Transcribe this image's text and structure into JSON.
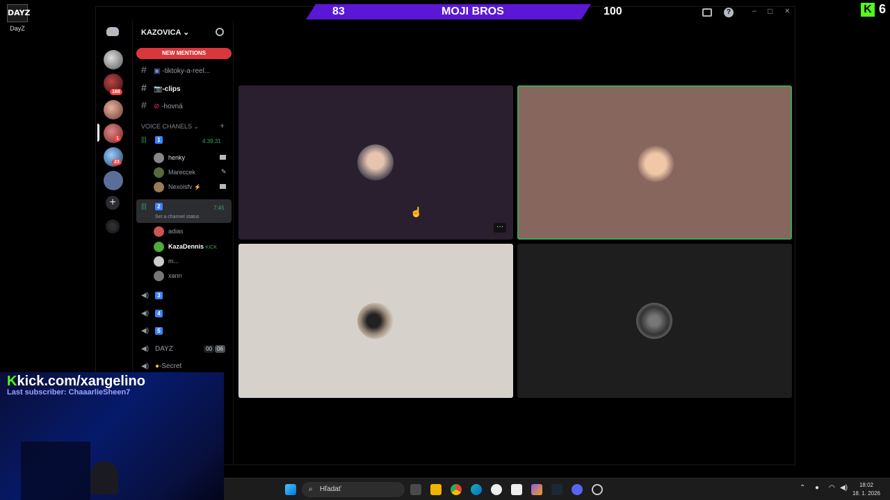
{
  "desktop": {
    "icon_label": "DayZ",
    "icon_text": "DAYZ"
  },
  "overlay_top_right": {
    "k": "K",
    "count": "6"
  },
  "scoreboard": {
    "left_score": "83",
    "title": "MOJI BROS",
    "right_score": "100"
  },
  "window_controls": {
    "inbox_icon": "inbox-icon",
    "help_icon": "?",
    "minimize": "–",
    "maximize": "□",
    "close": "✕"
  },
  "server": {
    "name": "KAZOVICA",
    "chevron": "⌄",
    "new_mentions": "NEW MENTIONS",
    "text_channels": [
      {
        "name": "-tiktoky-a-reel...",
        "emoji": "▣"
      },
      {
        "name": "-clips",
        "emoji": "📷"
      },
      {
        "name": "-hovná",
        "emoji": "⊘"
      }
    ],
    "voice_header": "VOICE CHANELS",
    "voice_header_chevron": "⌄",
    "add": "+",
    "voice_channels": [
      {
        "num": "1",
        "time": "4:39:31",
        "users": [
          "henky",
          "Mareccek",
          "Nexoisfv"
        ]
      },
      {
        "num": "2",
        "time": "7:45",
        "status": "Set a channel status",
        "users": [
          "adias",
          "KazaDennis",
          "m...",
          "xann"
        ],
        "user_tags": {
          "KazaDennis": "KICK",
          "m...": "FRI"
        }
      },
      {
        "num": "3"
      },
      {
        "num": "4"
      },
      {
        "num": "5"
      }
    ],
    "extra_channels": [
      {
        "name": "DAYZ",
        "counts": [
          "00",
          "06"
        ]
      },
      {
        "name": "-Secret"
      }
    ]
  },
  "rail_badges": {
    "b1": "168",
    "b2": "1",
    "b3": "23"
  },
  "kick": {
    "url": "kick.com/xangelino",
    "subscriber": "Last subscriber: ChaaarlieSheen7"
  },
  "tile_menu": "···",
  "taskbar": {
    "search_placeholder": "Hľadať",
    "time": "18:02",
    "date": "18. 1. 2026"
  },
  "colors": {
    "accent": "#5a18d6",
    "kick_green": "#53fc18",
    "speaking": "#3ba55c",
    "mentions": "#da373c"
  }
}
